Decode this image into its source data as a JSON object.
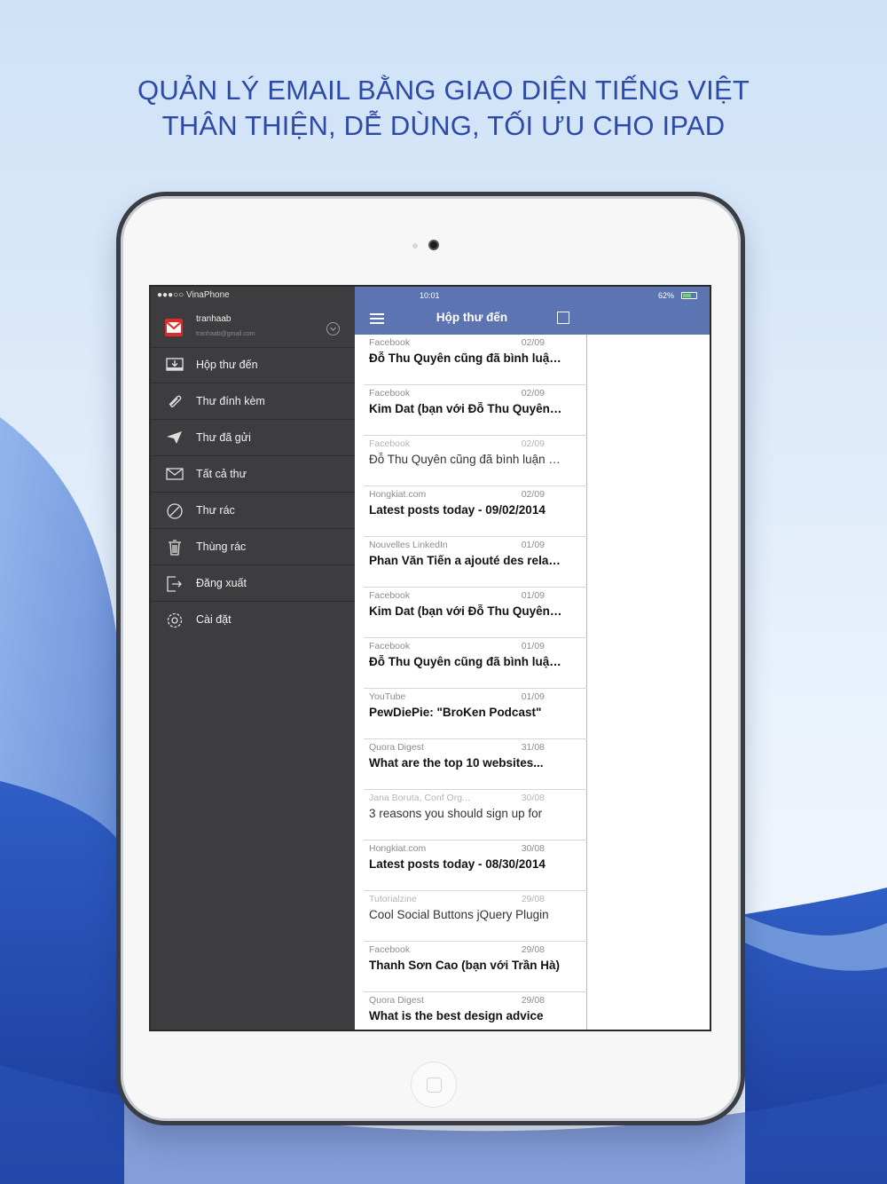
{
  "headline": {
    "line1": "QUẢN LÝ EMAIL BẰNG GIAO DIỆN TIẾNG VIỆT",
    "line2": "THÂN THIỆN, DỄ DÙNG, TỐI ƯU CHO IPAD"
  },
  "status_bar": {
    "carrier": "●●●○○ VinaPhone",
    "time": "10:01",
    "battery": "62%"
  },
  "account": {
    "name": "tranhaab",
    "email": "tranhaab@gmail.com"
  },
  "menu": [
    {
      "label": "Hộp thư đến",
      "icon": "inbox-icon"
    },
    {
      "label": "Thư đính kèm",
      "icon": "paperclip-icon"
    },
    {
      "label": "Thư đã gửi",
      "icon": "send-icon"
    },
    {
      "label": "Tất cả thư",
      "icon": "mail-icon"
    },
    {
      "label": "Thư rác",
      "icon": "spam-icon"
    },
    {
      "label": "Thùng rác",
      "icon": "trash-icon"
    },
    {
      "label": "Đăng xuất",
      "icon": "logout-icon"
    },
    {
      "label": "Cài đặt",
      "icon": "gear-icon"
    }
  ],
  "inbox": {
    "title": "Hộp thư đến",
    "messages": [
      {
        "from": "Facebook",
        "date": "02/09",
        "subject": "Đỗ Thu Quyên cũng đã bình luận về bài viết",
        "read": false
      },
      {
        "from": "Facebook",
        "date": "02/09",
        "subject": "Kim Dat (bạn với Đỗ Thu Quyên) đã bình luận",
        "read": false
      },
      {
        "from": "Facebook",
        "date": "02/09",
        "subject": "Đỗ Thu Quyên cũng đã bình luận về bài viết",
        "read": true
      },
      {
        "from": "Hongkiat.com",
        "date": "02/09",
        "subject": "Latest posts today - 09/02/2014",
        "read": false
      },
      {
        "from": "Nouvelles LinkedIn",
        "date": "01/09",
        "subject": "Phan Văn Tiến a ajouté des relations",
        "read": false
      },
      {
        "from": "Facebook",
        "date": "01/09",
        "subject": "Kim Dat (bạn với Đỗ Thu Quyên) đã bình luận",
        "read": false
      },
      {
        "from": "Facebook",
        "date": "01/09",
        "subject": "Đỗ Thu Quyên cũng đã bình luận về bài viết",
        "read": false
      },
      {
        "from": "YouTube",
        "date": "01/09",
        "subject": "PewDiePie: \"BroKen Podcast\"",
        "read": false
      },
      {
        "from": "Quora Digest",
        "date": "31/08",
        "subject": "What are the top 10 websites...",
        "read": false
      },
      {
        "from": "Jana Boruta, Conf Org...",
        "date": "30/08",
        "subject": "3 reasons you should sign up for",
        "read": true
      },
      {
        "from": "Hongkiat.com",
        "date": "30/08",
        "subject": "Latest posts today - 08/30/2014",
        "read": false
      },
      {
        "from": "Tutorialzine",
        "date": "29/08",
        "subject": "Cool Social Buttons jQuery Plugin",
        "read": true
      },
      {
        "from": "Facebook",
        "date": "29/08",
        "subject": "Thanh Sơn Cao (bạn với Trần Hà)",
        "read": false
      },
      {
        "from": "Quora Digest",
        "date": "29/08",
        "subject": "What is the best design advice",
        "read": false
      }
    ]
  },
  "colors": {
    "headline": "#2e4aa8",
    "topbar": "#5c74b2",
    "sidebar": "#3d3d3f",
    "gmail_red": "#e12a26"
  }
}
